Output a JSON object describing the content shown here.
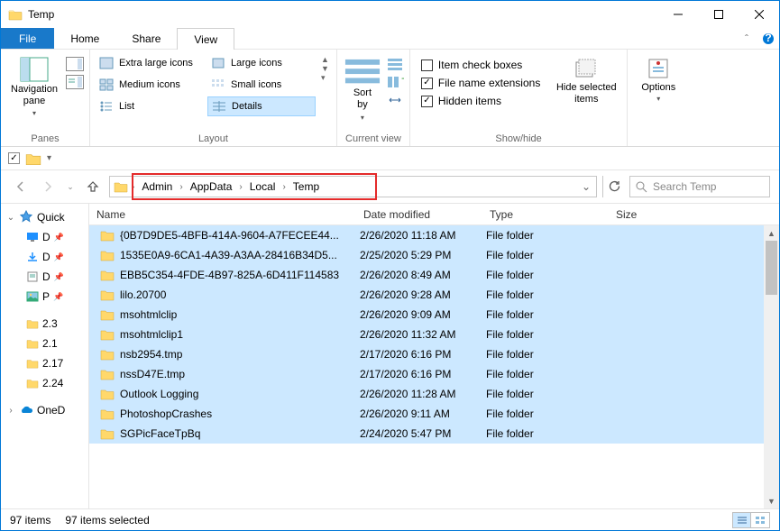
{
  "window": {
    "title": "Temp"
  },
  "menu": {
    "file": "File",
    "tabs": [
      "Home",
      "Share",
      "View"
    ],
    "active": "View"
  },
  "ribbon": {
    "panes": {
      "nav": "Navigation\npane",
      "group": "Panes"
    },
    "layout": {
      "items": [
        "Extra large icons",
        "Large icons",
        "Medium icons",
        "Small icons",
        "List",
        "Details"
      ],
      "selected": "Details",
      "group": "Layout"
    },
    "current_view": {
      "sort": "Sort\nby",
      "group": "Current view"
    },
    "show_hide": {
      "checks": [
        {
          "label": "Item check boxes",
          "checked": false
        },
        {
          "label": "File name extensions",
          "checked": true
        },
        {
          "label": "Hidden items",
          "checked": true
        }
      ],
      "hide": "Hide selected\nitems",
      "group": "Show/hide"
    },
    "options": "Options"
  },
  "breadcrumbs": [
    "Admin",
    "AppData",
    "Local",
    "Temp"
  ],
  "search": {
    "placeholder": "Search Temp"
  },
  "sidebar": {
    "quick": "Quick",
    "items": [
      "D",
      "D",
      "D",
      "P"
    ],
    "fixed": [
      "2.3",
      "2.1",
      "2.17",
      "2.24"
    ],
    "onedrive": "OneD"
  },
  "columns": {
    "name": "Name",
    "date": "Date modified",
    "type": "Type",
    "size": "Size"
  },
  "rows": [
    {
      "name": "{0B7D9DE5-4BFB-414A-9604-A7FECEE44...",
      "date": "2/26/2020 11:18 AM",
      "type": "File folder"
    },
    {
      "name": "1535E0A9-6CA1-4A39-A3AA-28416B34D5...",
      "date": "2/25/2020 5:29 PM",
      "type": "File folder"
    },
    {
      "name": "EBB5C354-4FDE-4B97-825A-6D411F114583",
      "date": "2/26/2020 8:49 AM",
      "type": "File folder"
    },
    {
      "name": "lilo.20700",
      "date": "2/26/2020 9:28 AM",
      "type": "File folder"
    },
    {
      "name": "msohtmlclip",
      "date": "2/26/2020 9:09 AM",
      "type": "File folder"
    },
    {
      "name": "msohtmlclip1",
      "date": "2/26/2020 11:32 AM",
      "type": "File folder"
    },
    {
      "name": "nsb2954.tmp",
      "date": "2/17/2020 6:16 PM",
      "type": "File folder"
    },
    {
      "name": "nssD47E.tmp",
      "date": "2/17/2020 6:16 PM",
      "type": "File folder"
    },
    {
      "name": "Outlook Logging",
      "date": "2/26/2020 11:28 AM",
      "type": "File folder"
    },
    {
      "name": "PhotoshopCrashes",
      "date": "2/26/2020 9:11 AM",
      "type": "File folder"
    },
    {
      "name": "SGPicFaceTpBq",
      "date": "2/24/2020 5:47 PM",
      "type": "File folder"
    }
  ],
  "status": {
    "items": "97 items",
    "selected": "97 items selected"
  }
}
